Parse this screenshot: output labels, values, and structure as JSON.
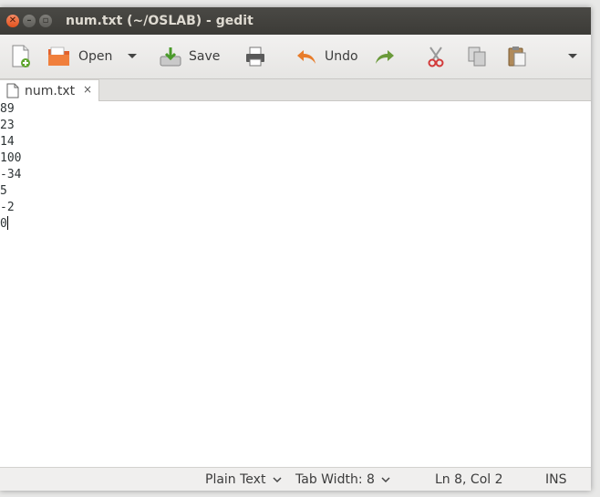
{
  "window": {
    "title": "num.txt (~/OSLAB) - gedit"
  },
  "toolbar": {
    "open_label": "Open",
    "save_label": "Save",
    "undo_label": "Undo"
  },
  "tabs": [
    {
      "label": "num.txt",
      "close_glyph": "×"
    }
  ],
  "editor": {
    "lines": [
      "89",
      "23",
      "14",
      "100",
      "-34",
      "5",
      "-2",
      "0"
    ],
    "cursor_line": 8
  },
  "statusbar": {
    "language": "Plain Text",
    "tab_width": "Tab Width: 8",
    "position": "Ln 8, Col 2",
    "mode": "INS"
  },
  "colors": {
    "titlebar": "#3c3b37",
    "close_button": "#e2521d",
    "undo_arrow": "#e87c2a",
    "redo_arrow": "#6a9a3a"
  }
}
